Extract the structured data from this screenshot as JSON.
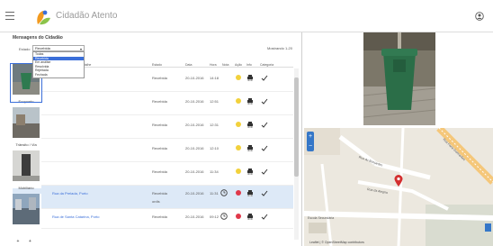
{
  "app": {
    "title": "Cidadão Atento"
  },
  "header": {
    "menu_icon": "hamburger-icon",
    "logo_icon": "logo-icon",
    "user_icon": "user-icon"
  },
  "panel": {
    "title": "Mensagens do Cidadão",
    "state_label": "Estado",
    "state_value": "Recebida",
    "showing": "Mostrando 1-20",
    "state_options": [
      "Todas",
      "Recebida",
      "Em análise",
      "Resolvida",
      "Rejeitada",
      "Fechada"
    ],
    "columns": [
      "Local / Detalhe",
      "Estado",
      "Data",
      "Hora",
      "Nota",
      "Ação",
      "Info",
      "Categoria"
    ]
  },
  "thumbnails": [
    {
      "caption": "Ecoponto"
    },
    {
      "caption": "Trânsito / Via"
    },
    {
      "caption": "Mobiliário"
    },
    {
      "caption": ""
    }
  ],
  "rows": [
    {
      "location": "",
      "state": "Recebida",
      "date": "20-10-2016",
      "time": "14:18",
      "dot_color": "#f2d13c"
    },
    {
      "location": "",
      "state": "Recebida",
      "date": "20-10-2016",
      "time": "12:51",
      "dot_color": "#f2d13c"
    },
    {
      "location": "",
      "state": "Recebida",
      "date": "20-10-2016",
      "time": "12:31",
      "dot_color": "#f2d13c"
    },
    {
      "location": "",
      "state": "Recebida",
      "date": "20-10-2016",
      "time": "12:10",
      "dot_color": "#f2d13c"
    },
    {
      "location": "",
      "state": "Recebida",
      "date": "20-10-2016",
      "time": "11:34",
      "dot_color": "#f2d13c"
    },
    {
      "location": "Rua da Prelada, Porto",
      "state": "Recebida",
      "date": "20-10-2016",
      "time": "11:31",
      "extra": "ordis",
      "dot_color": "#e0384a"
    },
    {
      "location": "Rua de Santa Catarina, Porto",
      "state": "Recebida",
      "date": "20-10-2016",
      "time": "09:12",
      "dot_color": "#e0384a"
    }
  ],
  "map": {
    "street_a": "Rua Faria Guimarães",
    "street_b": "Rua do Bonjardim",
    "street_c": "Rua da Alegria",
    "place": "Escola Secundária",
    "attribution": "Leaflet | © OpenStreetMap contributors"
  },
  "colors": {
    "accent": "#3b6fd9",
    "highlight": "#dde9f7",
    "marker": "#d32f2f"
  }
}
